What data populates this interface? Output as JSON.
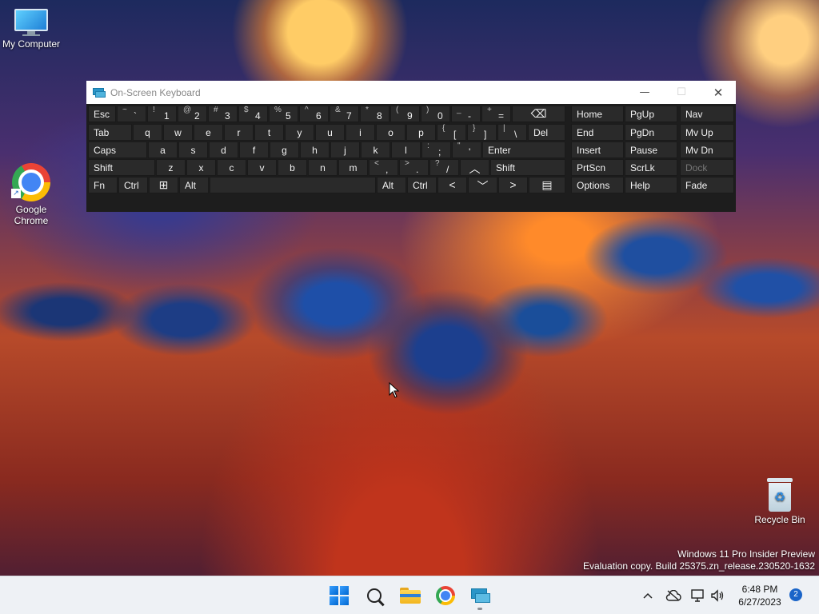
{
  "desktop": {
    "icons": [
      {
        "label": "My Computer"
      },
      {
        "label": "Google Chrome"
      },
      {
        "label": "Recycle Bin"
      }
    ],
    "watermark": {
      "line1": "Windows 11 Pro Insider Preview",
      "line2": "Evaluation copy. Build 25375.zn_release.230520-1632"
    }
  },
  "osk": {
    "title": "On-Screen Keyboard",
    "controls": {
      "minimize": "—",
      "maximize": "☐",
      "close": "✕"
    },
    "keys": {
      "esc": "Esc",
      "tilde_shift": "~",
      "tilde_main": "`",
      "n1_shift": "!",
      "n1": "1",
      "n2_shift": "@",
      "n2": "2",
      "n3_shift": "#",
      "n3": "3",
      "n4_shift": "$",
      "n4": "4",
      "n5_shift": "%",
      "n5": "5",
      "n6_shift": "^",
      "n6": "6",
      "n7_shift": "&",
      "n7": "7",
      "n8_shift": "*",
      "n8": "8",
      "n9_shift": "(",
      "n9": "9",
      "n0_shift": ")",
      "n0": "0",
      "minus_shift": "_",
      "minus": "-",
      "plus_shift": "+",
      "plus": "=",
      "backspace": "⌫",
      "tab": "Tab",
      "q": "q",
      "w": "w",
      "e": "e",
      "r": "r",
      "t": "t",
      "y": "y",
      "u": "u",
      "i": "i",
      "o": "o",
      "p": "p",
      "lbrace_shift": "{",
      "lbrace": "[",
      "rbrace_shift": "}",
      "rbrace": "]",
      "pipe_shift": "|",
      "backslash": "\\",
      "del": "Del",
      "caps": "Caps",
      "a": "a",
      "s": "s",
      "d": "d",
      "f": "f",
      "g": "g",
      "h": "h",
      "j": "j",
      "k": "k",
      "l": "l",
      "colon_shift": ":",
      "semicolon": ";",
      "quote_shift": "\"",
      "quote": "'",
      "enter": "Enter",
      "lshift": "Shift",
      "z": "z",
      "x": "x",
      "c": "c",
      "v": "v",
      "b": "b",
      "n": "n",
      "m": "m",
      "lt_shift": "<",
      "comma": ",",
      "gt_shift": ">",
      "period": ".",
      "question_shift": "?",
      "slash": "/",
      "up": "︿",
      "rshift": "Shift",
      "fn": "Fn",
      "lctrl": "Ctrl",
      "win": "⊞",
      "lalt": "Alt",
      "ralt": "Alt",
      "rctrl": "Ctrl",
      "left": "<",
      "down": "﹀",
      "right": ">",
      "menu": "▤",
      "home": "Home",
      "pgup": "PgUp",
      "nav": "Nav",
      "end": "End",
      "pgdn": "PgDn",
      "mvup": "Mv Up",
      "insert": "Insert",
      "pause": "Pause",
      "mvdn": "Mv Dn",
      "prtscn": "PrtScn",
      "scrlk": "ScrLk",
      "dock": "Dock",
      "options": "Options",
      "help": "Help",
      "fade": "Fade"
    }
  },
  "taskbar": {
    "apps": [
      {
        "icon": "windows-start-icon"
      },
      {
        "icon": "search-icon"
      },
      {
        "icon": "file-explorer-icon"
      },
      {
        "icon": "chrome-icon"
      },
      {
        "icon": "on-screen-keyboard-icon"
      }
    ],
    "tray": {
      "chevron": "^",
      "time": "6:48 PM",
      "date": "6/27/2023",
      "notifications": "2"
    }
  }
}
